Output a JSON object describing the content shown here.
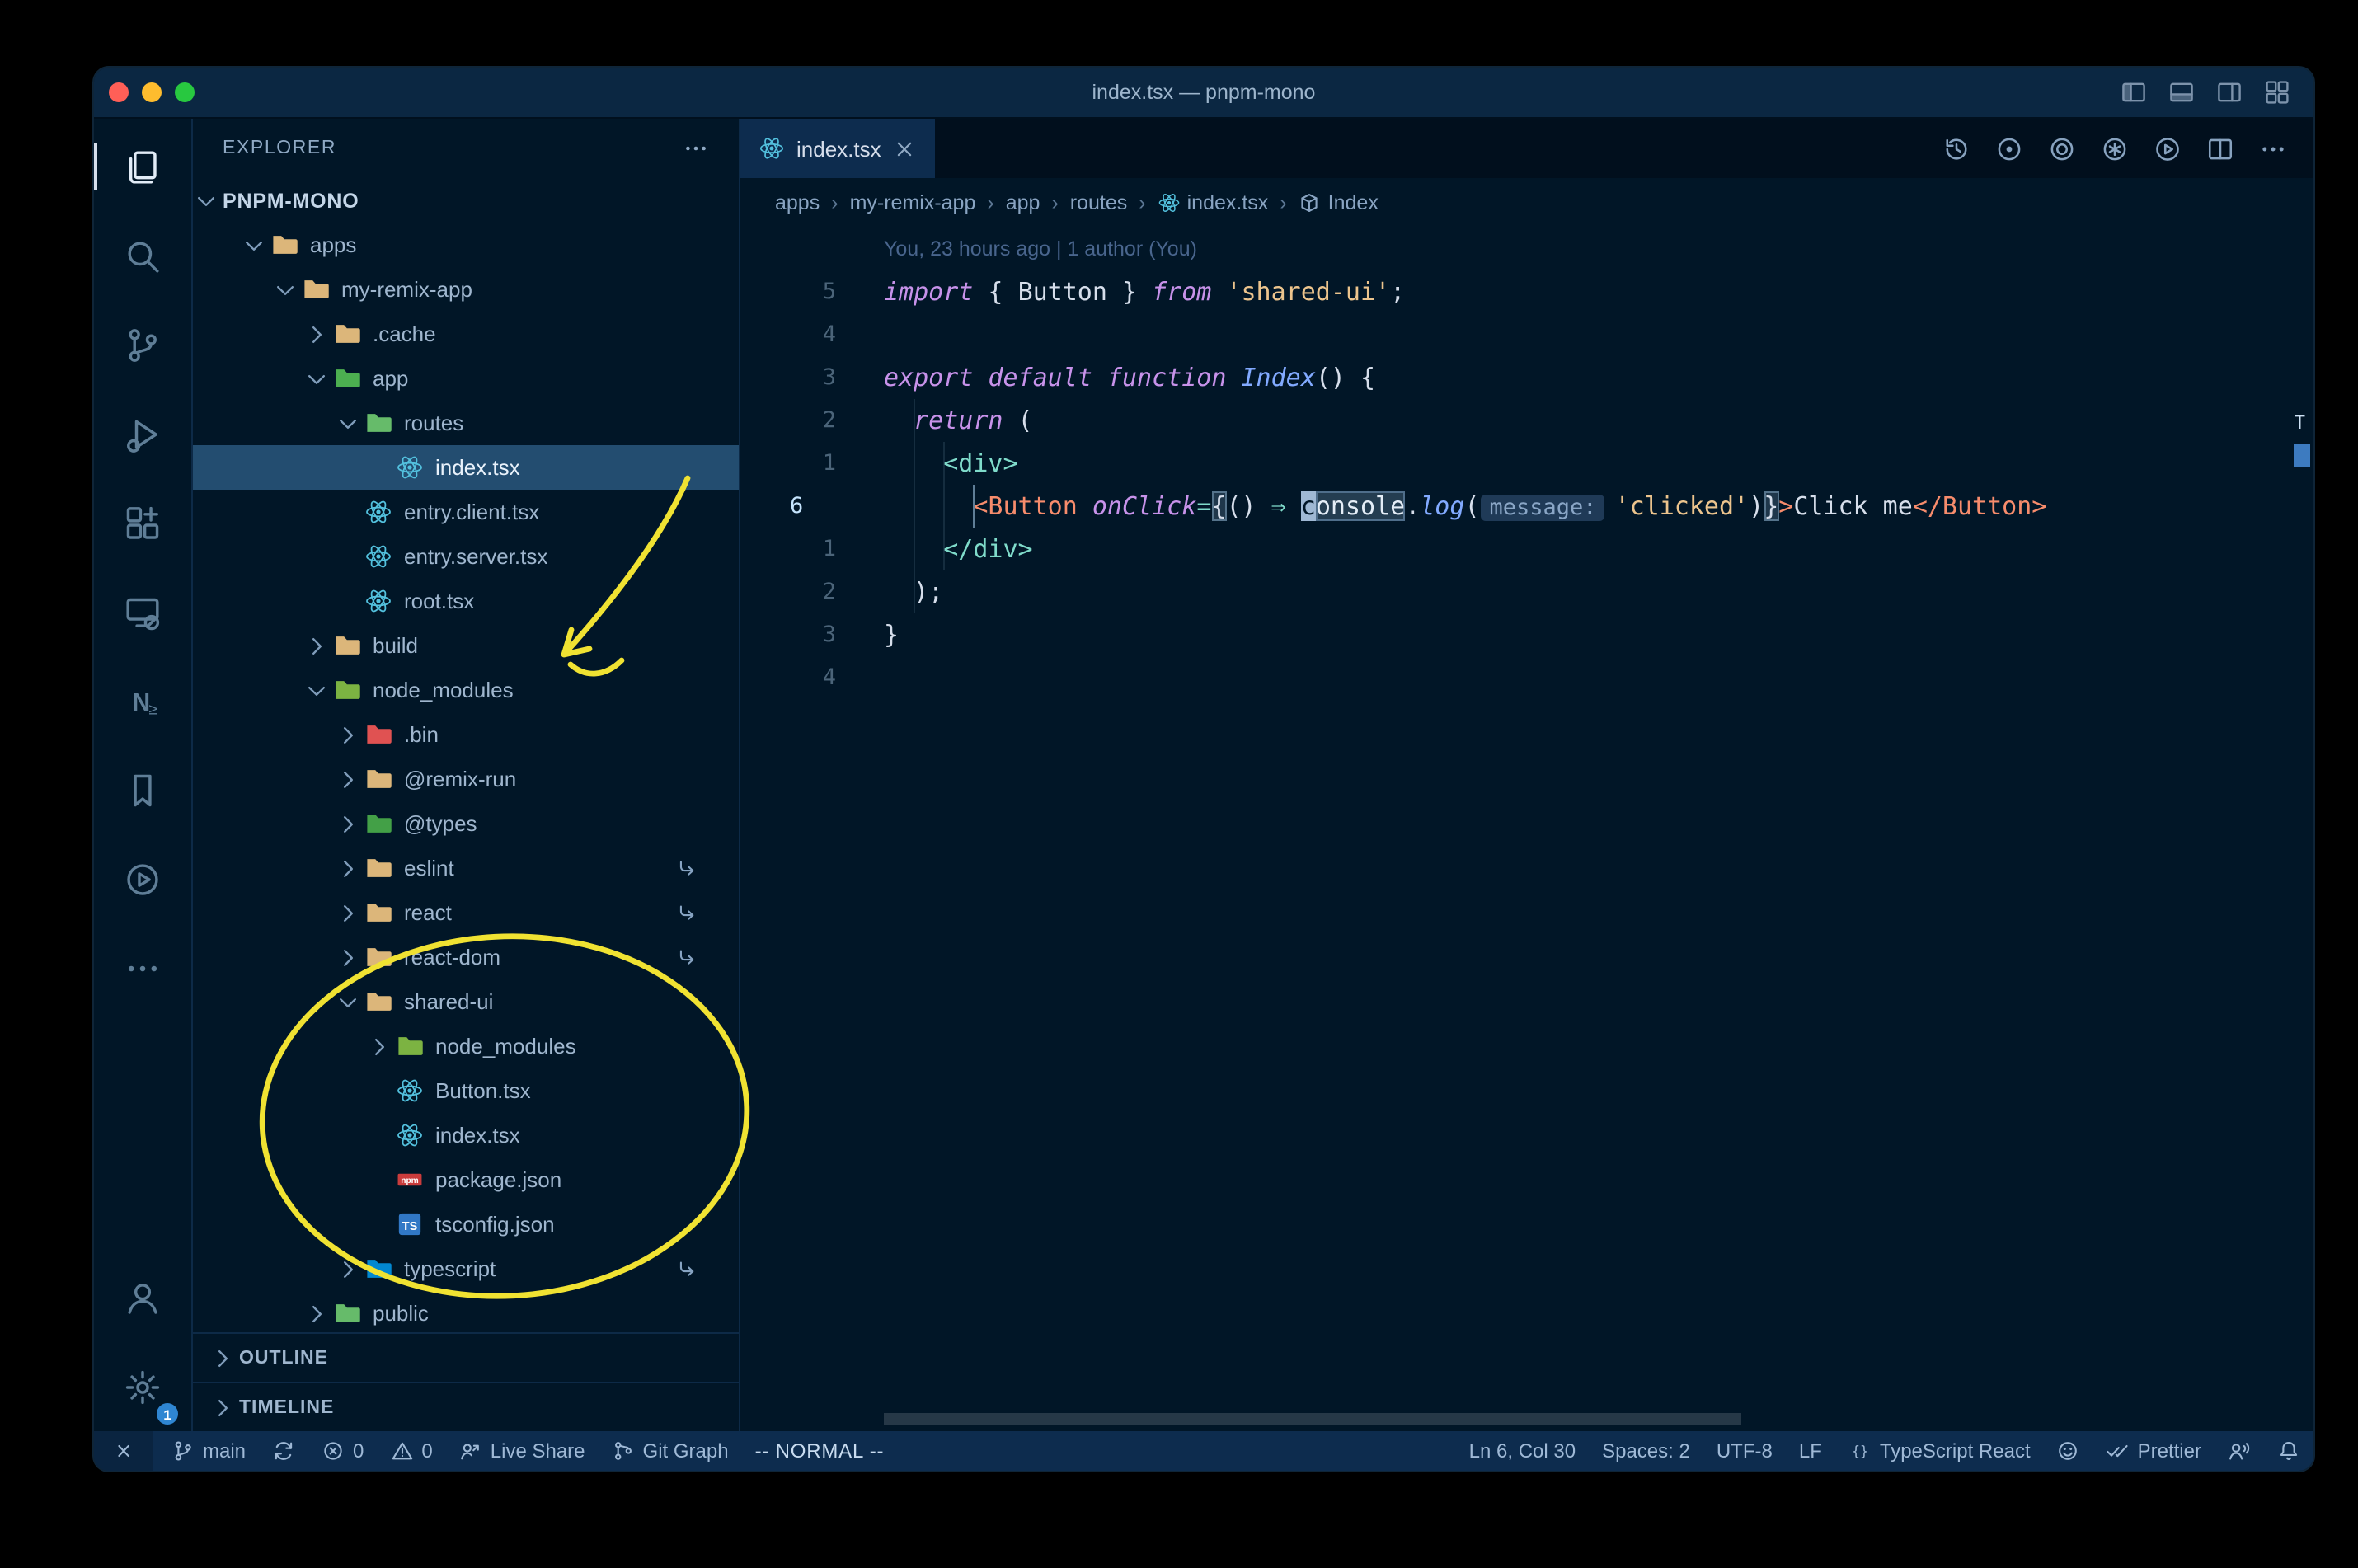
{
  "window": {
    "title": "index.tsx — pnpm-mono"
  },
  "titlebar": {
    "actions": [
      {
        "name": "toggle-primary-sidebar-icon",
        "icon": "layout-sidebar-left-icon"
      },
      {
        "name": "toggle-panel-icon",
        "icon": "layout-panel-icon"
      },
      {
        "name": "toggle-secondary-sidebar-icon",
        "icon": "layout-sidebar-right-icon"
      },
      {
        "name": "customize-layout-icon",
        "icon": "layout-customize-icon"
      }
    ]
  },
  "activity_bar": {
    "top": [
      {
        "name": "activity-explorer",
        "icon": "files-icon",
        "active": true
      },
      {
        "name": "activity-search",
        "icon": "search-icon"
      },
      {
        "name": "activity-source-control",
        "icon": "source-control-icon"
      },
      {
        "name": "activity-run-debug",
        "icon": "run-debug-icon"
      },
      {
        "name": "activity-extensions",
        "icon": "extensions-icon"
      },
      {
        "name": "activity-remote-explorer",
        "icon": "remote-explorer-icon"
      },
      {
        "name": "activity-nx-console",
        "icon": "nx-icon"
      },
      {
        "name": "activity-bookmarks",
        "icon": "bookmark-icon"
      },
      {
        "name": "activity-live-preview",
        "icon": "play-circle-icon"
      },
      {
        "name": "activity-more-views",
        "icon": "ellipsis-icon"
      }
    ],
    "bottom": [
      {
        "name": "activity-accounts",
        "icon": "account-icon"
      },
      {
        "name": "activity-settings",
        "icon": "gear-icon",
        "badge": "1"
      }
    ]
  },
  "sidebar": {
    "header": "EXPLORER",
    "root": "PNPM-MONO",
    "tree": [
      {
        "label": "apps",
        "level": 1,
        "kind": "folder",
        "state": "open",
        "color": "#dcb67a"
      },
      {
        "label": "my-remix-app",
        "level": 2,
        "kind": "folder",
        "state": "open",
        "color": "#dcb67a"
      },
      {
        "label": ".cache",
        "level": 3,
        "kind": "folder",
        "state": "closed",
        "color": "#dcb67a"
      },
      {
        "label": "app",
        "level": 3,
        "kind": "folder",
        "state": "open",
        "color": "#4caf50"
      },
      {
        "label": "routes",
        "level": 4,
        "kind": "folder",
        "state": "open",
        "color": "#66bb6a"
      },
      {
        "label": "index.tsx",
        "level": 5,
        "kind": "file",
        "icon": "react-icon",
        "selected": true
      },
      {
        "label": "entry.client.tsx",
        "level": 4,
        "kind": "file",
        "icon": "react-icon"
      },
      {
        "label": "entry.server.tsx",
        "level": 4,
        "kind": "file",
        "icon": "react-icon"
      },
      {
        "label": "root.tsx",
        "level": 4,
        "kind": "file",
        "icon": "react-icon"
      },
      {
        "label": "build",
        "level": 3,
        "kind": "folder",
        "state": "closed",
        "color": "#dcb67a"
      },
      {
        "label": "node_modules",
        "level": 3,
        "kind": "folder",
        "state": "open",
        "color": "#7cb342"
      },
      {
        "label": ".bin",
        "level": 4,
        "kind": "folder",
        "state": "closed",
        "color": "#e05252"
      },
      {
        "label": "@remix-run",
        "level": 4,
        "kind": "folder",
        "state": "closed",
        "color": "#dcb67a"
      },
      {
        "label": "@types",
        "level": 4,
        "kind": "folder",
        "state": "closed",
        "color": "#43a047"
      },
      {
        "label": "eslint",
        "level": 4,
        "kind": "folder",
        "state": "closed",
        "color": "#dcb67a",
        "symlink": true
      },
      {
        "label": "react",
        "level": 4,
        "kind": "folder",
        "state": "closed",
        "color": "#dcb67a",
        "symlink": true
      },
      {
        "label": "react-dom",
        "level": 4,
        "kind": "folder",
        "state": "closed",
        "color": "#dcb67a",
        "symlink": true
      },
      {
        "label": "shared-ui",
        "level": 4,
        "kind": "folder",
        "state": "open",
        "color": "#dcb67a"
      },
      {
        "label": "node_modules",
        "level": 5,
        "kind": "folder",
        "state": "closed",
        "color": "#7cb342"
      },
      {
        "label": "Button.tsx",
        "level": 5,
        "kind": "file",
        "icon": "react-icon"
      },
      {
        "label": "index.tsx",
        "level": 5,
        "kind": "file",
        "icon": "react-icon"
      },
      {
        "label": "package.json",
        "level": 5,
        "kind": "file",
        "icon": "npm-icon"
      },
      {
        "label": "tsconfig.json",
        "level": 5,
        "kind": "file",
        "icon": "ts-icon"
      },
      {
        "label": "typescript",
        "level": 4,
        "kind": "folder",
        "state": "closed",
        "color": "#0288d1",
        "symlink": true
      },
      {
        "label": "public",
        "level": 3,
        "kind": "folder",
        "state": "closed",
        "color": "#66bb6a"
      }
    ],
    "sections": [
      "OUTLINE",
      "TIMELINE"
    ]
  },
  "tabs": {
    "items": [
      {
        "label": "index.tsx",
        "icon": "react-icon",
        "active": true
      }
    ]
  },
  "editor_actions": [
    {
      "name": "timeline-history",
      "icon": "history-icon"
    },
    {
      "name": "toggle-file-blame",
      "icon": "circle-dot-icon"
    },
    {
      "name": "open-changes",
      "icon": "circle-ring-icon"
    },
    {
      "name": "file-annotations",
      "icon": "circle-star-icon"
    },
    {
      "name": "run-file",
      "icon": "run-icon"
    },
    {
      "name": "split-editor",
      "icon": "split-editor-icon"
    },
    {
      "name": "more-actions",
      "icon": "ellipsis-icon"
    }
  ],
  "breadcrumbs_sep": "›",
  "breadcrumbs": [
    {
      "label": "apps"
    },
    {
      "label": "my-remix-app"
    },
    {
      "label": "app"
    },
    {
      "label": "routes"
    },
    {
      "label": "index.tsx",
      "icon": "react-icon"
    },
    {
      "label": "Index",
      "icon": "symbol-icon"
    }
  ],
  "editor": {
    "blame": "You, 23 hours ago | 1 author (You)",
    "ruler_decoration": "T",
    "lines": [
      {
        "n": "5",
        "t": [
          [
            "kw",
            "import"
          ],
          [
            "pun",
            " { "
          ],
          [
            "pun",
            "Button"
          ],
          [
            "pun",
            " } "
          ],
          [
            "kw",
            "from"
          ],
          [
            "pun",
            " "
          ],
          [
            "str",
            "'shared-ui'"
          ],
          [
            "pun",
            ";"
          ]
        ]
      },
      {
        "n": "4",
        "t": []
      },
      {
        "n": "3",
        "t": [
          [
            "kw",
            "export"
          ],
          [
            "pun",
            " "
          ],
          [
            "kw",
            "default"
          ],
          [
            "pun",
            " "
          ],
          [
            "kw",
            "function"
          ],
          [
            "pun",
            " "
          ],
          [
            "fn",
            "Index"
          ],
          [
            "pun",
            "() {"
          ]
        ]
      },
      {
        "n": "2",
        "t": [
          [
            "pun",
            "  "
          ],
          [
            "kw",
            "return"
          ],
          [
            "pun",
            " ("
          ]
        ]
      },
      {
        "n": "1",
        "t": [
          [
            "pun",
            "    "
          ],
          [
            "tag",
            "<div>"
          ]
        ]
      },
      {
        "n": "6",
        "cur": true,
        "t": [
          [
            "pun",
            "      "
          ],
          [
            "cmp",
            "<Button"
          ],
          [
            "pun",
            " "
          ],
          [
            "kw",
            "onClick"
          ],
          [
            "op",
            "="
          ],
          [
            "bm",
            "{"
          ],
          [
            "pun",
            "() "
          ],
          [
            "op",
            "⇒"
          ],
          [
            "pun",
            " "
          ],
          [
            "cursor",
            "c"
          ],
          [
            "hl",
            "onsole"
          ],
          [
            "pun",
            "."
          ],
          [
            "fn",
            "log"
          ],
          [
            "pun",
            "("
          ],
          [
            "inlay",
            "message:"
          ],
          [
            "str",
            "'clicked'"
          ],
          [
            "pun",
            ")"
          ],
          [
            "bm",
            "}"
          ],
          [
            "cmp",
            ">"
          ],
          [
            "txt",
            "Click me"
          ],
          [
            "cmp",
            "</Button>"
          ]
        ]
      },
      {
        "n": "1",
        "t": [
          [
            "pun",
            "    "
          ],
          [
            "tag",
            "</div>"
          ]
        ]
      },
      {
        "n": "2",
        "t": [
          [
            "pun",
            "  );"
          ]
        ]
      },
      {
        "n": "3",
        "t": [
          [
            "pun",
            "}"
          ]
        ]
      },
      {
        "n": "4",
        "t": []
      }
    ]
  },
  "status_bar": {
    "left": [
      {
        "name": "remote-indicator",
        "icon": "remote-icon",
        "boxed": true
      },
      {
        "name": "git-branch",
        "icon": "branch-icon",
        "label": "main"
      },
      {
        "name": "sync-changes",
        "icon": "sync-icon"
      },
      {
        "name": "problems-errors",
        "icon": "error-icon",
        "label": "0"
      },
      {
        "name": "problems-warnings",
        "icon": "warning-icon",
        "label": "0"
      },
      {
        "name": "live-share",
        "icon": "live-share-icon",
        "label": "Live Share"
      },
      {
        "name": "git-graph",
        "icon": "git-graph-icon",
        "label": "Git Graph"
      },
      {
        "name": "vim-mode",
        "label": "-- NORMAL --",
        "cls": "vim"
      }
    ],
    "right": [
      {
        "name": "cursor-position",
        "label": "Ln 6, Col 30"
      },
      {
        "name": "indentation",
        "label": "Spaces: 2"
      },
      {
        "name": "encoding",
        "label": "UTF-8"
      },
      {
        "name": "eol-sequence",
        "label": "LF"
      },
      {
        "name": "language-mode",
        "icon": "braces-icon",
        "label": "TypeScript React"
      },
      {
        "name": "feedback-smiley",
        "icon": "smiley-icon"
      },
      {
        "name": "prettier",
        "icon": "double-check-icon",
        "label": "Prettier"
      },
      {
        "name": "tunnel-voice",
        "icon": "person-voice-icon"
      },
      {
        "name": "notifications",
        "icon": "bell-icon"
      }
    ]
  }
}
